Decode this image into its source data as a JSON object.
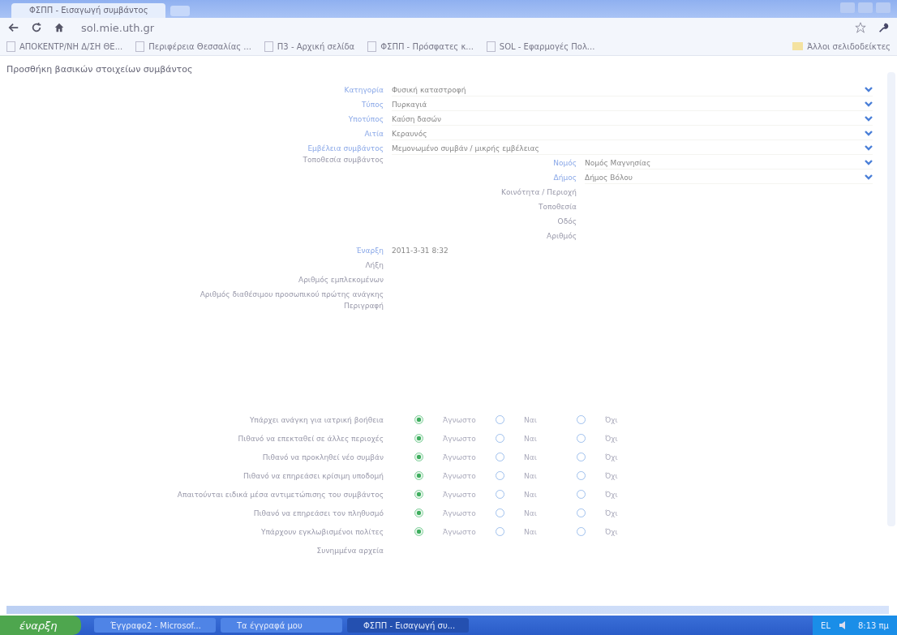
{
  "browser": {
    "tab_title": "ΦΣΠΠ - Εισαγωγή συμβάντος",
    "address": "sol.mie.uth.gr",
    "bookmarks": [
      "ΑΠΟΚΕΝΤΡ/ΝΗ Δ/ΣΗ ΘΕ...",
      "Περιφέρεια Θεσσαλίας ...",
      "Π3 - Αρχική σελίδα",
      "ΦΣΠΠ - Πρόσφατες κ...",
      "SOL - Εφαρμογές Πολ..."
    ],
    "other_bookmarks": "Άλλοι σελιδοδείκτες"
  },
  "heading": "Προσθήκη βασικών στοιχείων συμβάντος",
  "fields": [
    {
      "label": "Κατηγορία",
      "value": "Φυσική καταστροφή",
      "kind": "select"
    },
    {
      "label": "Τύπος",
      "value": "Πυρκαγιά",
      "kind": "select"
    },
    {
      "label": "Υποτύπος",
      "value": "Καύση δασών",
      "kind": "select"
    },
    {
      "label": "Αιτία",
      "value": "Κεραυνός",
      "kind": "select"
    },
    {
      "label": "Εμβέλεια συμβάντος",
      "value": "Μεμονωμένο συμβάν / μικρής εμβέλειας",
      "kind": "select"
    }
  ],
  "location": {
    "label": "Τοποθεσία συμβάντος",
    "fields": [
      {
        "label": "Νομός",
        "value": "Νομός Μαγνησίας",
        "kind": "select"
      },
      {
        "label": "Δήμος",
        "value": "Δήμος Βόλου",
        "kind": "select"
      },
      {
        "label": "Κοινότητα / Περιοχή",
        "kind": "text"
      },
      {
        "label": "Τοποθεσία",
        "kind": "text"
      },
      {
        "label": "Οδός",
        "kind": "text"
      },
      {
        "label": "Αριθμός",
        "kind": "text"
      }
    ]
  },
  "details": [
    {
      "label": "Έναρξη",
      "value": "2011-3-31 8:32",
      "kind": "text"
    },
    {
      "label": "Λήξη",
      "kind": "text"
    },
    {
      "label": "Αριθμός εμπλεκομένων",
      "kind": "text"
    },
    {
      "label": "Αριθμός διαθέσιμου προσωπικού πρώτης ανάγκης",
      "kind": "text"
    },
    {
      "label": "Περιγραφή",
      "kind": "textarea"
    }
  ],
  "questions": [
    {
      "label": "Υπάρχει ανάγκη για ιατρική βοήθεια",
      "options": [
        {
          "label": "Άγνωστο",
          "selected": true
        },
        {
          "label": "Ναι",
          "selected": false
        },
        {
          "label": "Όχι",
          "selected": false
        }
      ]
    },
    {
      "label": "Πιθανό να επεκταθεί σε άλλες περιοχές",
      "options": [
        {
          "label": "Άγνωστο",
          "selected": true
        },
        {
          "label": "Ναι",
          "selected": false
        },
        {
          "label": "Όχι",
          "selected": false
        }
      ]
    },
    {
      "label": "Πιθανό να προκληθεί νέο συμβάν",
      "options": [
        {
          "label": "Άγνωστο",
          "selected": true
        },
        {
          "label": "Ναι",
          "selected": false
        },
        {
          "label": "Όχι",
          "selected": false
        }
      ]
    },
    {
      "label": "Πιθανό να επηρεάσει κρίσιμη υποδομή",
      "options": [
        {
          "label": "Άγνωστο",
          "selected": true
        },
        {
          "label": "Ναι",
          "selected": false
        },
        {
          "label": "Όχι",
          "selected": false
        }
      ]
    },
    {
      "label": "Απαιτούνται ειδικά μέσα αντιμετώπισης του συμβάντος",
      "options": [
        {
          "label": "Άγνωστο",
          "selected": true
        },
        {
          "label": "Ναι",
          "selected": false
        },
        {
          "label": "Όχι",
          "selected": false
        }
      ]
    },
    {
      "label": "Πιθανό να επηρεάσει τον πληθυσμό",
      "options": [
        {
          "label": "Άγνωστο",
          "selected": true
        },
        {
          "label": "Ναι",
          "selected": false
        },
        {
          "label": "Όχι",
          "selected": false
        }
      ]
    },
    {
      "label": "Υπάρχουν εγκλωβισμένοι πολίτες",
      "options": [
        {
          "label": "Άγνωστο",
          "selected": true
        },
        {
          "label": "Ναι",
          "selected": false
        },
        {
          "label": "Όχι",
          "selected": false
        }
      ]
    }
  ],
  "attachments_label": "Συνημμένα αρχεία",
  "taskbar": {
    "start": "έναρξη",
    "tasks": [
      {
        "label": "Έγγραφο2 - Microsof...",
        "selected": false
      },
      {
        "label": "Τα έγγραφά μου",
        "selected": false
      },
      {
        "label": "ΦΣΠΠ - Εισαγωγή συ...",
        "selected": true
      }
    ],
    "language": "EL",
    "clock": "8:13 πμ"
  }
}
